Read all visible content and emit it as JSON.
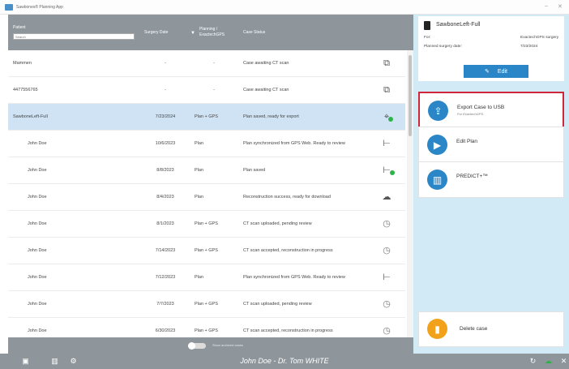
{
  "window": {
    "title": "Sawbones® Planning App",
    "minimize": "–",
    "close": "✕"
  },
  "table": {
    "headers": {
      "patient": "Patient",
      "surgery_date": "Surgery Date",
      "planning": "Planning / ExactechGPS",
      "case_status": "Case Status"
    },
    "search_placeholder": "Search",
    "rows": [
      {
        "patient": "Mammen",
        "date": "-",
        "planning": "-",
        "status": "Case awaiting CT scan",
        "icon": "copy-icon",
        "selected": false,
        "indent": false
      },
      {
        "patient": "4477556765",
        "date": "-",
        "planning": "-",
        "status": "Case awaiting CT scan",
        "icon": "copy-icon",
        "selected": false,
        "indent": false
      },
      {
        "patient": "SawboneLeft-Full",
        "date": "7/23/2024",
        "planning": "Plan + GPS",
        "status": "Plan saved, ready for export",
        "icon": "gps-check-icon",
        "selected": true,
        "indent": false
      },
      {
        "patient": "John Doe",
        "date": "10/6/2023",
        "planning": "Plan",
        "status": "Plan synchronized from GPS Web. Ready to review",
        "icon": "plan-arrow-icon",
        "selected": false,
        "indent": true
      },
      {
        "patient": "John Doe",
        "date": "8/8/2023",
        "planning": "Plan",
        "status": "Plan saved",
        "icon": "plan-check-icon",
        "selected": false,
        "indent": true
      },
      {
        "patient": "John Doe",
        "date": "8/4/2023",
        "planning": "Plan",
        "status": "Reconstruction success, ready for download",
        "icon": "cloud-download-icon",
        "selected": false,
        "indent": true
      },
      {
        "patient": "John Doe",
        "date": "8/1/2023",
        "planning": "Plan + GPS",
        "status": "CT scan uploaded, pending review",
        "icon": "clock-icon",
        "selected": false,
        "indent": true
      },
      {
        "patient": "John Doe",
        "date": "7/14/2023",
        "planning": "Plan + GPS",
        "status": "CT scan accepted, reconstruction in progress",
        "icon": "clock-icon",
        "selected": false,
        "indent": true
      },
      {
        "patient": "John Doe",
        "date": "7/12/2023",
        "planning": "Plan",
        "status": "Plan synchronized from GPS Web. Ready to review",
        "icon": "plan-arrow-icon",
        "selected": false,
        "indent": true
      },
      {
        "patient": "John Doe",
        "date": "7/7/2023",
        "planning": "Plan + GPS",
        "status": "CT scan uploaded, pending review",
        "icon": "clock-icon",
        "selected": false,
        "indent": true
      },
      {
        "patient": "John Doe",
        "date": "6/30/2023",
        "planning": "Plan + GPS",
        "status": "CT scan accepted, reconstruction in progress",
        "icon": "clock-icon",
        "selected": false,
        "indent": true
      }
    ],
    "toggle_label": "Show archived cases"
  },
  "case_panel": {
    "name": "SawboneLeft-Full",
    "for_label": "For:",
    "for_value": "ExactechGPS surgery",
    "date_label": "Planned surgery date:",
    "date_value": "7/23/2024",
    "edit_label": "Edit"
  },
  "actions": {
    "export_label": "Export Case to USB",
    "export_sub": "For ExactechGPS",
    "edit_plan_label": "Edit Plan",
    "predict_label": "PREDICT+™",
    "delete_label": "Delete case"
  },
  "footer": {
    "text": "John Doe - Dr. Tom WHITE"
  },
  "colors": {
    "accent": "#2b86c7",
    "header_gray": "#8e969c",
    "highlight_border": "#d0263b",
    "status_green": "#2fb24a",
    "panel_bg": "#d2e9f6"
  }
}
